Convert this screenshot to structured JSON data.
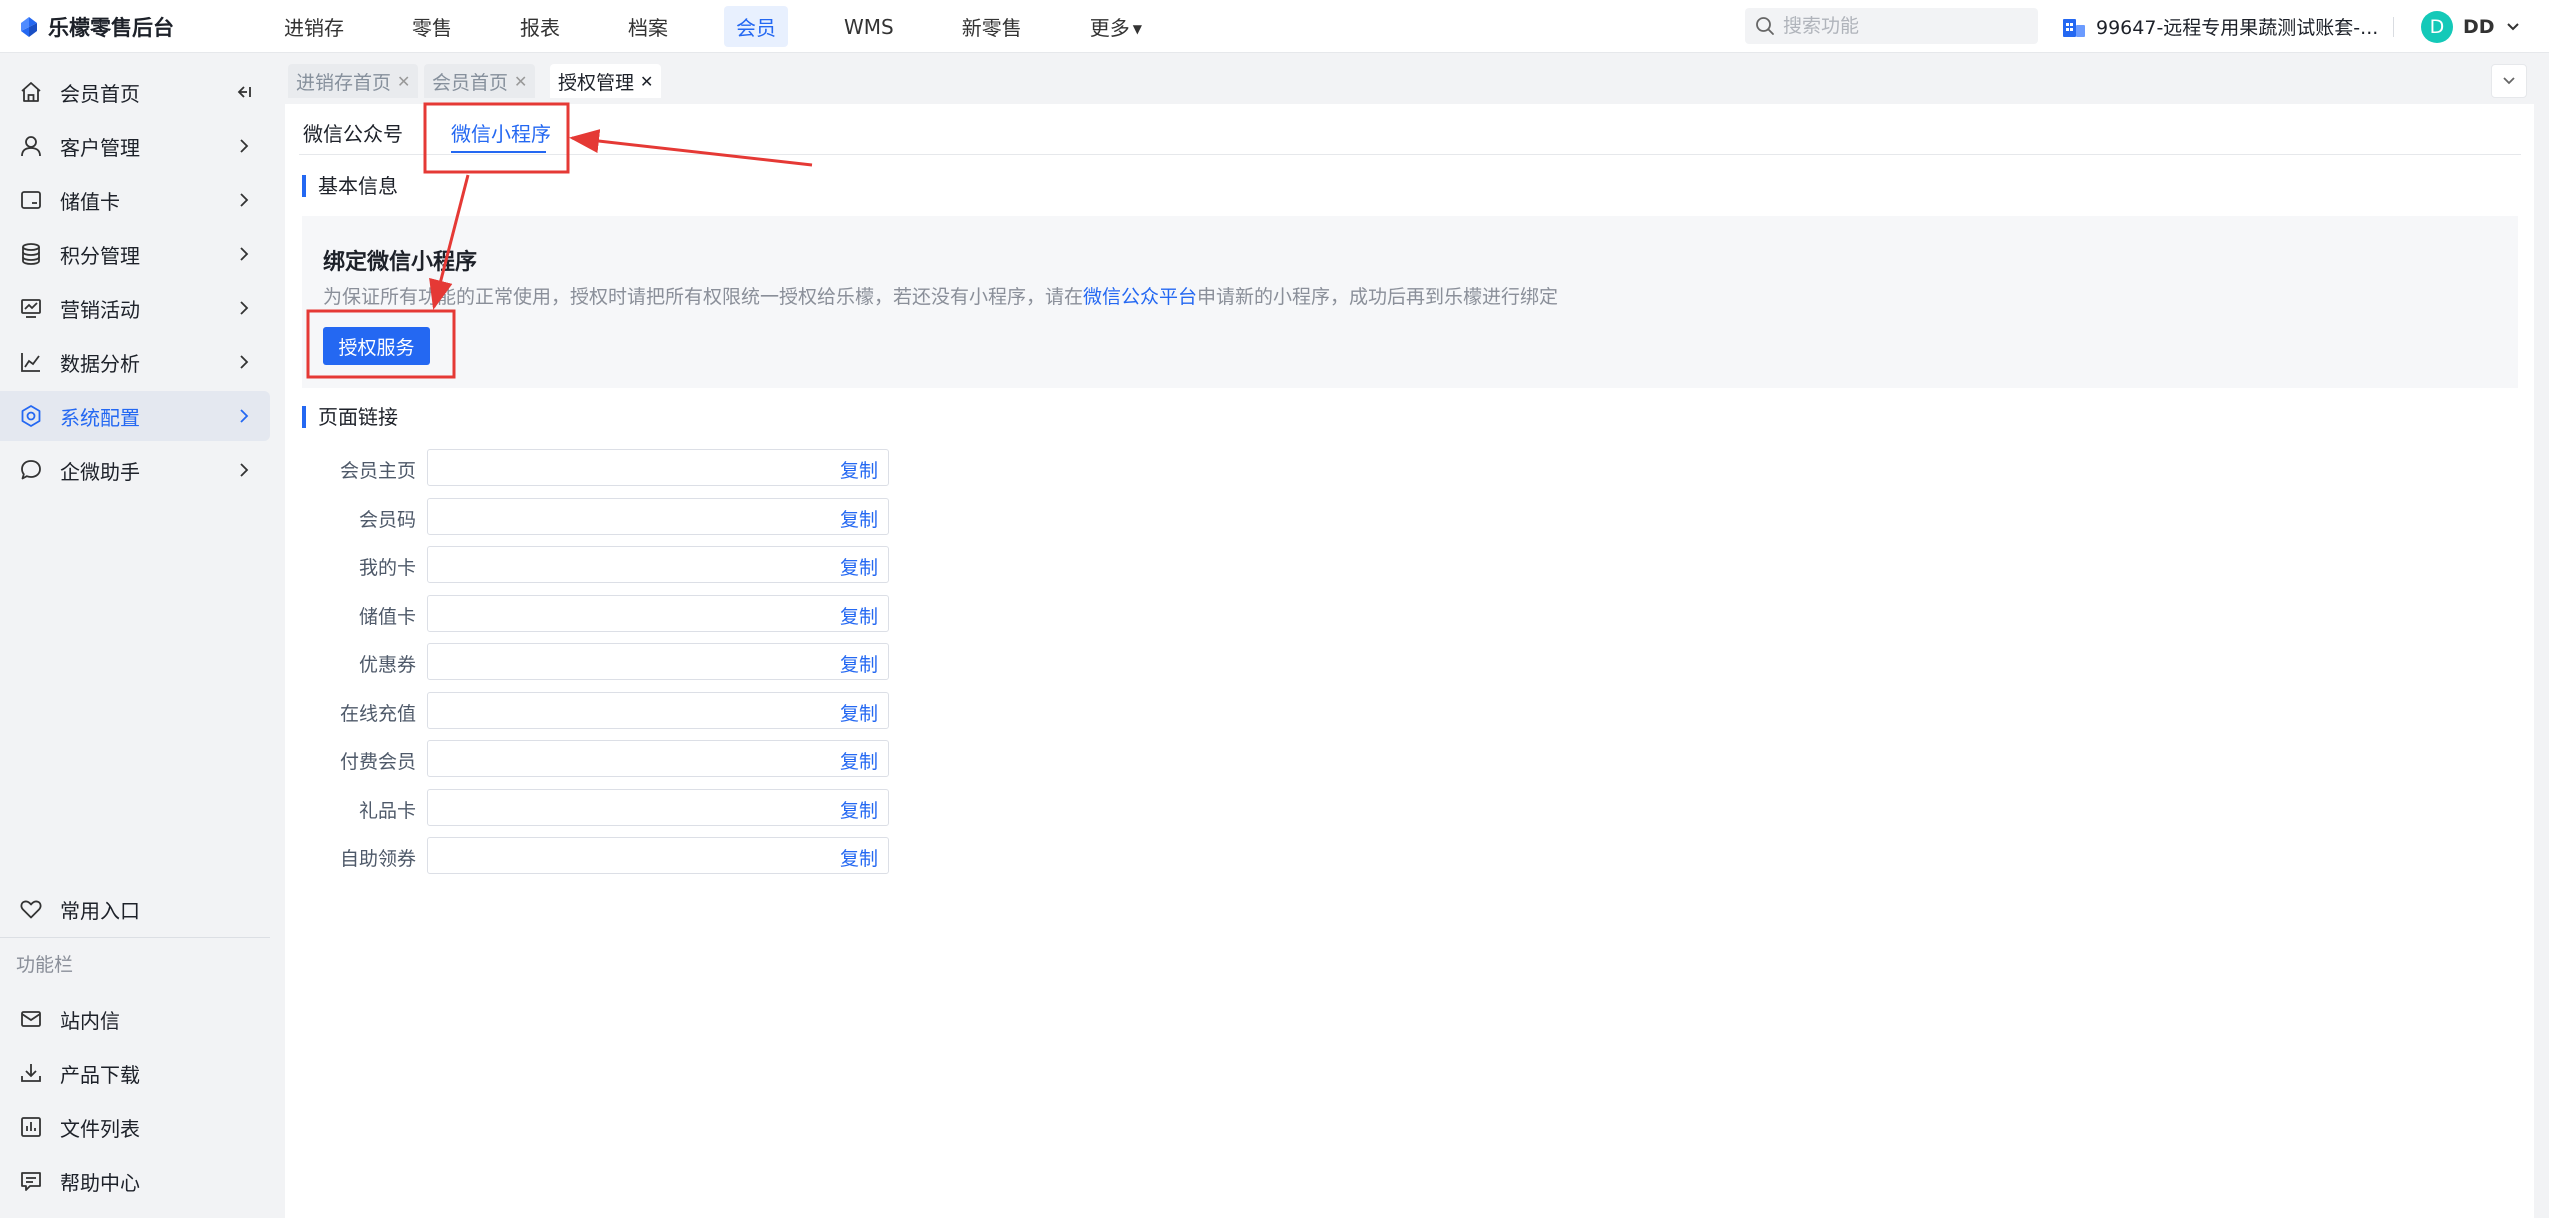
{
  "app": {
    "brand_name": "乐檬零售后台"
  },
  "topnav": {
    "items": [
      {
        "label": "进销存"
      },
      {
        "label": "零售"
      },
      {
        "label": "报表"
      },
      {
        "label": "档案"
      },
      {
        "label": "会员",
        "active": true
      },
      {
        "label": "WMS"
      },
      {
        "label": "新零售"
      },
      {
        "label": "更多"
      }
    ],
    "search_placeholder": "搜索功能",
    "account_name": "99647-远程专用果蔬测试账套-...",
    "user_initial": "D",
    "user_name": "DD"
  },
  "sidebar": {
    "items": [
      {
        "label": "会员首页",
        "icon": "home-icon"
      },
      {
        "label": "客户管理",
        "icon": "user-icon"
      },
      {
        "label": "储值卡",
        "icon": "card-icon"
      },
      {
        "label": "积分管理",
        "icon": "database-icon"
      },
      {
        "label": "营销活动",
        "icon": "promotion-icon"
      },
      {
        "label": "数据分析",
        "icon": "chart-icon"
      },
      {
        "label": "系统配置",
        "icon": "settings-icon",
        "active": true
      },
      {
        "label": "企微助手",
        "icon": "chat-icon"
      }
    ],
    "favorites_label": "常用入口",
    "section_label": "功能栏",
    "tools": [
      {
        "label": "站内信",
        "icon": "mail-icon"
      },
      {
        "label": "产品下载",
        "icon": "download-icon"
      },
      {
        "label": "文件列表",
        "icon": "file-list-icon"
      },
      {
        "label": "帮助中心",
        "icon": "help-icon"
      }
    ]
  },
  "tabs": [
    {
      "label": "进销存首页"
    },
    {
      "label": "会员首页"
    },
    {
      "label": "授权管理",
      "active": true
    }
  ],
  "main": {
    "subtabs": [
      {
        "label": "微信公众号"
      },
      {
        "label": "微信小程序",
        "active": true
      }
    ],
    "basic_info_title": "基本信息",
    "bind_card": {
      "title": "绑定微信小程序",
      "desc_prefix": "为保证所有功能的正常使用，授权时请把所有权限统一授权给乐檬，若还没有小程序，请在",
      "desc_link": "微信公众平台",
      "desc_suffix": "申请新的小程序，成功后再到乐檬进行绑定",
      "button_label": "授权服务"
    },
    "page_links_title": "页面链接",
    "copy_label": "复制",
    "links": [
      {
        "label": "会员主页",
        "value": ""
      },
      {
        "label": "会员码",
        "value": ""
      },
      {
        "label": "我的卡",
        "value": ""
      },
      {
        "label": "储值卡",
        "value": ""
      },
      {
        "label": "优惠券",
        "value": ""
      },
      {
        "label": "在线充值",
        "value": ""
      },
      {
        "label": "付费会员",
        "value": ""
      },
      {
        "label": "礼品卡",
        "value": ""
      },
      {
        "label": "自助领券",
        "value": ""
      }
    ]
  },
  "colors": {
    "primary": "#2468f2",
    "annotation": "#e53935"
  }
}
